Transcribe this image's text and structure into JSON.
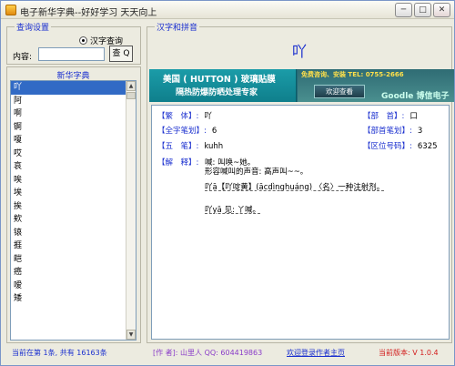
{
  "window": {
    "title": "电子新华字典--好好学习 天天向上",
    "buttons": {
      "minimize": "─",
      "maximize": "□",
      "close": "✕"
    }
  },
  "query_settings": {
    "title": "查询设置",
    "radio_label": "汉字查询",
    "content_label": "内容:",
    "input_value": "",
    "query_button": "查 Q"
  },
  "dictionary": {
    "header": "新华字典",
    "items": [
      "吖",
      "阿",
      "啊",
      "锕",
      "嗄",
      "哎",
      "哀",
      "唉",
      "埃",
      "挨",
      "欸",
      "锿",
      "捱",
      "皑",
      "癌",
      "嗳",
      "矮"
    ],
    "selected_index": 0
  },
  "hanzi_pinyin": {
    "title": "汉字和拼音",
    "character": "吖"
  },
  "ad_banner": {
    "title": "美国 ( HUTTON ) 玻璃贴膜",
    "subtitle": "隔热防爆防晒处理专家",
    "contact": "免费咨询、安装 TEL: 0755-2666",
    "button": "欢迎查看",
    "brand": "Goodle 博信电子"
  },
  "details": {
    "traditional": {
      "label": "【繁　体】:",
      "value": "吖"
    },
    "radical": {
      "label": "【部　首】:",
      "value": "口"
    },
    "total_strokes": {
      "label": "【全字笔划】:",
      "value": "6"
    },
    "radical_strokes": {
      "label": "【部首笔划】:",
      "value": "3"
    },
    "wubi": {
      "label": "【五　笔】:",
      "value": "kuhh"
    },
    "area_code": {
      "label": "【区位号码】:",
      "value": "6325"
    },
    "explanation_label": "【解　释】:",
    "explanation_lines": [
      "喊: 叫唤~她。",
      "形容喊叫的声音: 高声叫~~。",
      "吖ā【吖啶黄】(ācdìnghuáng) 〈名〉一种注射剂。",
      "吖yā 见: 丫喊。"
    ]
  },
  "status_bar": {
    "left": "当前在第 1条, 共有 16163条",
    "author": "[作 者]: 山里人 QQ: 604419863",
    "link": "欢迎登录作者主页",
    "version": "当前版本: V 1.0.4"
  }
}
